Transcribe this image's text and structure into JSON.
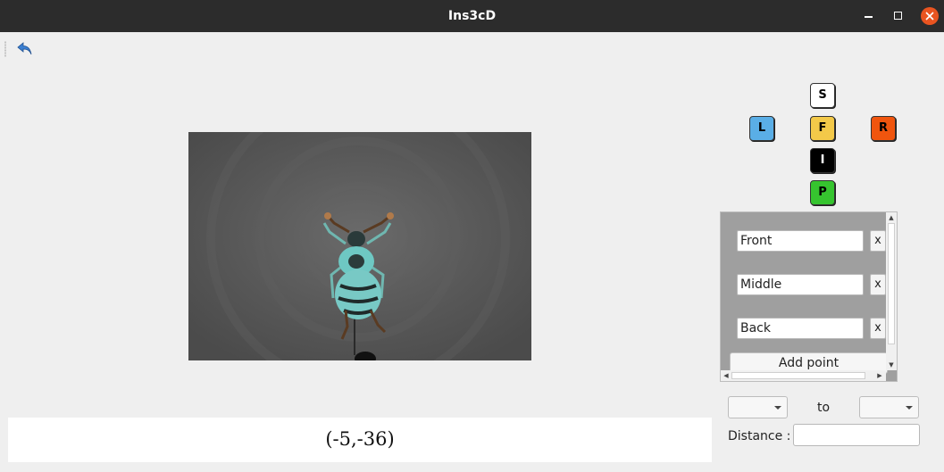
{
  "window": {
    "title": "Ins3cD",
    "accent_color": "#e95420"
  },
  "toolbar": {
    "undo_icon": "undo-arrow-icon"
  },
  "viewer": {
    "coordinates": "(-5,-36)"
  },
  "view_buttons": {
    "superior": {
      "label": "S",
      "color": "#ffffff"
    },
    "left": {
      "label": "L",
      "color": "#5aaee6"
    },
    "front": {
      "label": "F",
      "color": "#f3c949"
    },
    "right": {
      "label": "R",
      "color": "#f0550e"
    },
    "inferior": {
      "label": "I",
      "color": "#000000"
    },
    "posterior": {
      "label": "P",
      "color": "#36c42f"
    }
  },
  "points": {
    "items": [
      {
        "name": "Front",
        "remove_label": "x"
      },
      {
        "name": "Middle",
        "remove_label": "x"
      },
      {
        "name": "Back",
        "remove_label": "x"
      }
    ],
    "add_label": "Add point"
  },
  "measure": {
    "from_value": "",
    "to_label": "to",
    "to_value": "",
    "distance_label": "Distance :",
    "distance_value": ""
  }
}
